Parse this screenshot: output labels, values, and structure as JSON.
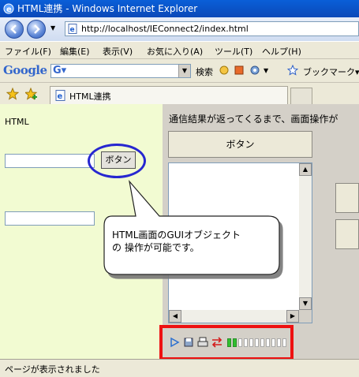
{
  "window": {
    "title": "HTML連携 - Windows Internet Explorer"
  },
  "address": {
    "url": "http://localhost/IEConnect2/index.html"
  },
  "menu": {
    "items": [
      "ファイル(F)",
      "編集(E)",
      "表示(V)",
      "お気に入り(A)",
      "ツール(T)",
      "ヘルプ(H)"
    ]
  },
  "googlebar": {
    "logo": "Google",
    "search_label": "検索",
    "bookmark_label": "ブックマーク▾"
  },
  "tabs": [
    {
      "label": "HTML連携"
    }
  ],
  "left_pane": {
    "heading": "HTML",
    "button_label": "ボタン"
  },
  "right_pane": {
    "notice": "通信結果が返ってくるまで、画面操作が",
    "button_label": "ボタン"
  },
  "callout": {
    "line1": "HTML画面のGUIオブジェクト",
    "line2": "の 操作が可能です。"
  },
  "progress": {
    "segments_total": 11,
    "segments_filled": 2
  },
  "status": {
    "text": "ページが表示されました"
  },
  "colors": {
    "left_pane_bg": "#f2fbd2",
    "highlight_ellipse": "#2727d0",
    "highlight_box": "#ee1111",
    "progress_fill": "#2fbf2f"
  }
}
